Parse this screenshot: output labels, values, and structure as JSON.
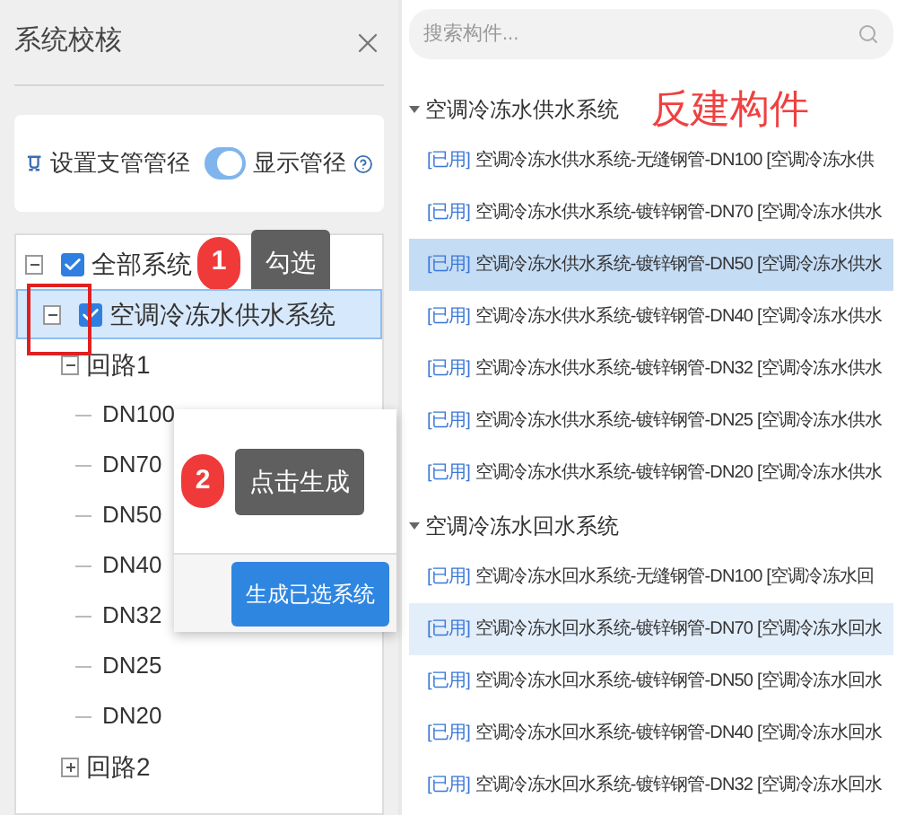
{
  "panel": {
    "title": "系统校核"
  },
  "options": {
    "branch_label": "设置支管管径",
    "toggle": {
      "label": "显示管径",
      "on": true
    }
  },
  "tree": [
    {
      "label": "全部系统",
      "checked": true,
      "expanded": true,
      "selected": false,
      "children": [
        {
          "label": "空调冷冻水供水系统",
          "checked": true,
          "expanded": true,
          "selected": true,
          "children": [
            {
              "label": "回路1",
              "expanded": true,
              "children": [
                {
                  "label": "DN100"
                },
                {
                  "label": "DN70"
                },
                {
                  "label": "DN50"
                },
                {
                  "label": "DN40"
                },
                {
                  "label": "DN32"
                },
                {
                  "label": "DN25"
                },
                {
                  "label": "DN20"
                }
              ]
            },
            {
              "label": "回路2",
              "expanded": false
            }
          ]
        }
      ]
    }
  ],
  "callouts": [
    {
      "number": "1",
      "text": "勾选"
    },
    {
      "number": "2",
      "text": "点击生成"
    }
  ],
  "generate_button": "生成已选系统",
  "search": {
    "placeholder": "搜索构件..."
  },
  "annotation": "反建构件",
  "groups": [
    {
      "title": "空调冷冻水供水系统",
      "expanded": true,
      "items": [
        {
          "tag": "[已用]",
          "text": "空调冷冻水供水系统-无缝钢管-DN100 [空调冷冻水供",
          "selected": false
        },
        {
          "tag": "[已用]",
          "text": "空调冷冻水供水系统-镀锌钢管-DN70 [空调冷冻水供水",
          "selected": false
        },
        {
          "tag": "[已用]",
          "text": "空调冷冻水供水系统-镀锌钢管-DN50 [空调冷冻水供水",
          "selected": true
        },
        {
          "tag": "[已用]",
          "text": "空调冷冻水供水系统-镀锌钢管-DN40 [空调冷冻水供水",
          "selected": false
        },
        {
          "tag": "[已用]",
          "text": "空调冷冻水供水系统-镀锌钢管-DN32 [空调冷冻水供水",
          "selected": false
        },
        {
          "tag": "[已用]",
          "text": "空调冷冻水供水系统-镀锌钢管-DN25 [空调冷冻水供水",
          "selected": false
        },
        {
          "tag": "[已用]",
          "text": "空调冷冻水供水系统-镀锌钢管-DN20 [空调冷冻水供水",
          "selected": false
        }
      ]
    },
    {
      "title": "空调冷冻水回水系统",
      "expanded": true,
      "items": [
        {
          "tag": "[已用]",
          "text": "空调冷冻水回水系统-无缝钢管-DN100 [空调冷冻水回",
          "selected": false
        },
        {
          "tag": "[已用]",
          "text": "空调冷冻水回水系统-镀锌钢管-DN70 [空调冷冻水回水",
          "selected": true
        },
        {
          "tag": "[已用]",
          "text": "空调冷冻水回水系统-镀锌钢管-DN50 [空调冷冻水回水",
          "selected": false
        },
        {
          "tag": "[已用]",
          "text": "空调冷冻水回水系统-镀锌钢管-DN40 [空调冷冻水回水",
          "selected": false
        },
        {
          "tag": "[已用]",
          "text": "空调冷冻水回水系统-镀锌钢管-DN32 [空调冷冻水回水",
          "selected": false
        }
      ]
    }
  ]
}
